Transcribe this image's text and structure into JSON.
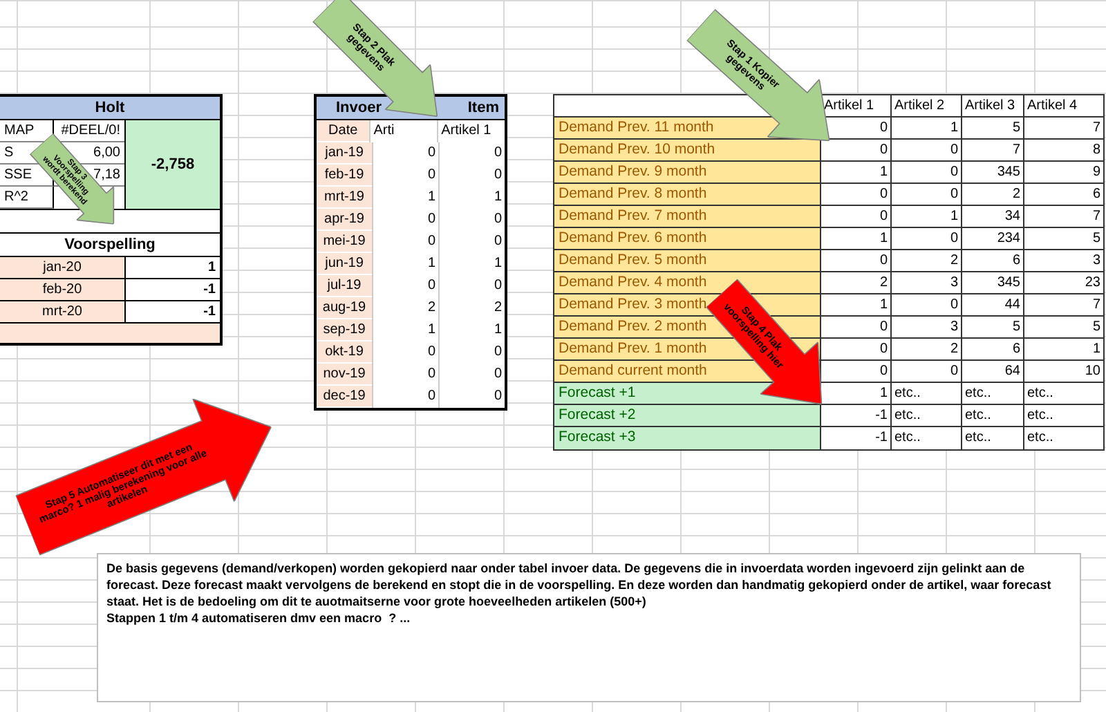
{
  "holt": {
    "title": "Holt",
    "metrics": [
      {
        "label": "MAP",
        "value": "#DEEL/0!"
      },
      {
        "label": "S",
        "value": "6,00"
      },
      {
        "label": "SSE",
        "value": "7,18"
      },
      {
        "label": "R^2"
      }
    ],
    "result": "-2,758"
  },
  "voorspelling": {
    "title": "Voorspelling",
    "rows": [
      {
        "date": "jan-20",
        "value": "1"
      },
      {
        "date": "feb-20",
        "value": "-1"
      },
      {
        "date": "mrt-20",
        "value": "-1"
      }
    ]
  },
  "invoer": {
    "title_parts": [
      "Invoer",
      "Item"
    ],
    "columns": [
      "Date",
      "Arti",
      "Artikel 1"
    ],
    "rows": [
      [
        "jan-19",
        "0",
        "0"
      ],
      [
        "feb-19",
        "0",
        "0"
      ],
      [
        "mrt-19",
        "1",
        "1"
      ],
      [
        "apr-19",
        "0",
        "0"
      ],
      [
        "mei-19",
        "0",
        "0"
      ],
      [
        "jun-19",
        "1",
        "1"
      ],
      [
        "jul-19",
        "0",
        "0"
      ],
      [
        "aug-19",
        "2",
        "2"
      ],
      [
        "sep-19",
        "1",
        "1"
      ],
      [
        "okt-19",
        "0",
        "0"
      ],
      [
        "nov-19",
        "0",
        "0"
      ],
      [
        "dec-19",
        "0",
        "0"
      ]
    ]
  },
  "demand_table": {
    "columns": [
      "Artikel 1",
      "Artikel 2",
      "Artikel 3",
      "Artikel 4"
    ],
    "rows": [
      {
        "kind": "demand",
        "label": "Demand Prev. 11 month",
        "values": [
          "0",
          "1",
          "5",
          "7"
        ]
      },
      {
        "kind": "demand",
        "label": "Demand Prev. 10 month",
        "values": [
          "0",
          "0",
          "7",
          "8"
        ]
      },
      {
        "kind": "demand",
        "label": "Demand Prev. 9 month",
        "values": [
          "1",
          "0",
          "345",
          "9"
        ]
      },
      {
        "kind": "demand",
        "label": "Demand Prev. 8 month",
        "values": [
          "0",
          "0",
          "2",
          "6"
        ]
      },
      {
        "kind": "demand",
        "label": "Demand Prev. 7 month",
        "values": [
          "0",
          "1",
          "34",
          "7"
        ]
      },
      {
        "kind": "demand",
        "label": "Demand Prev. 6 month",
        "values": [
          "1",
          "0",
          "234",
          "5"
        ]
      },
      {
        "kind": "demand",
        "label": "Demand Prev. 5 month",
        "values": [
          "0",
          "2",
          "6",
          "3"
        ]
      },
      {
        "kind": "demand",
        "label": "Demand Prev. 4 month",
        "values": [
          "2",
          "3",
          "345",
          "23"
        ]
      },
      {
        "kind": "demand",
        "label": "Demand Prev. 3 month",
        "values": [
          "1",
          "0",
          "44",
          "7"
        ]
      },
      {
        "kind": "demand",
        "label": "Demand Prev. 2 month",
        "values": [
          "0",
          "3",
          "5",
          "5"
        ]
      },
      {
        "kind": "demand",
        "label": "Demand Prev. 1 month",
        "values": [
          "0",
          "2",
          "6",
          "1"
        ]
      },
      {
        "kind": "demand",
        "label": "Demand current month",
        "values": [
          "0",
          "0",
          "64",
          "10"
        ]
      },
      {
        "kind": "forecast",
        "label": "Forecast +1",
        "values": [
          "1",
          "etc..",
          "etc..",
          "etc.."
        ]
      },
      {
        "kind": "forecast",
        "label": "Forecast +2",
        "values": [
          "-1",
          "etc..",
          "etc..",
          "etc.."
        ]
      },
      {
        "kind": "forecast",
        "label": "Forecast +3",
        "values": [
          "-1",
          "etc..",
          "etc..",
          "etc.."
        ]
      }
    ]
  },
  "callouts": [
    {
      "text": "Stap 1  Kopier gegevens",
      "color": "#a9d18e"
    },
    {
      "text": "Stap 2 Plak gegevens",
      "color": "#a9d18e"
    },
    {
      "text": "Stap 3 Voorspelling wordt berekend",
      "color": "#a9d18e"
    },
    {
      "text": "Stap 4 Plak voorspelling hier",
      "color": "#ff0000"
    },
    {
      "text": "Stap 5  Automatiseer dit met een marco? 1 malig berekening voor alle artikelen",
      "color": "#ff0000"
    }
  ],
  "note": "De basis gegevens (demand/verkopen) worden gekopierd naar onder tabel invoer data. De gegevens die in invoerdata worden ingevoerd zijn gelinkt aan de forecast. Deze forecast maakt vervolgens de berekend en stopt die in de voorspelling. En deze worden dan handmatig gekopierd onder de artikel, waar forecast staat. Het is de bedoeling om dit te auotmaitserne voor grote hoeveelheden artikelen (500+)\nStappen 1 t/m 4 automatiseren dmv een macro  ? ..."
}
